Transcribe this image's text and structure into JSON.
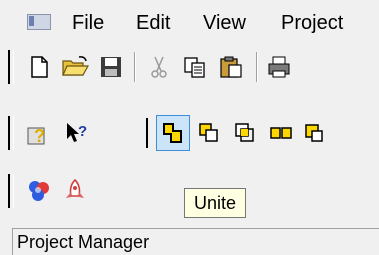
{
  "menubar": {
    "items": [
      {
        "label": "File"
      },
      {
        "label": "Edit"
      },
      {
        "label": "View"
      },
      {
        "label": "Project"
      }
    ]
  },
  "toolbar_standard": {
    "buttons": [
      "new-document-icon",
      "open-folder-icon",
      "save-icon",
      "cut-icon",
      "copy-icon",
      "paste-icon",
      "print-icon"
    ]
  },
  "toolbar_help_boolean": {
    "buttons": [
      "help-book-icon",
      "context-help-icon",
      "unite-icon",
      "subtract-icon",
      "intersect-icon",
      "split-icon",
      "overlap-icon"
    ],
    "active": "unite-icon"
  },
  "toolbar_3d": {
    "buttons": [
      "molecule-icon",
      "rocket-icon"
    ]
  },
  "tooltip": {
    "text": "Unite"
  },
  "panel": {
    "title": "Project Manager"
  },
  "colors": {
    "accent_yellow": "#ffd700",
    "active_border": "#3e8ede",
    "active_fill": "#cce4f7",
    "tooltip_bg": "#ffffe1"
  }
}
